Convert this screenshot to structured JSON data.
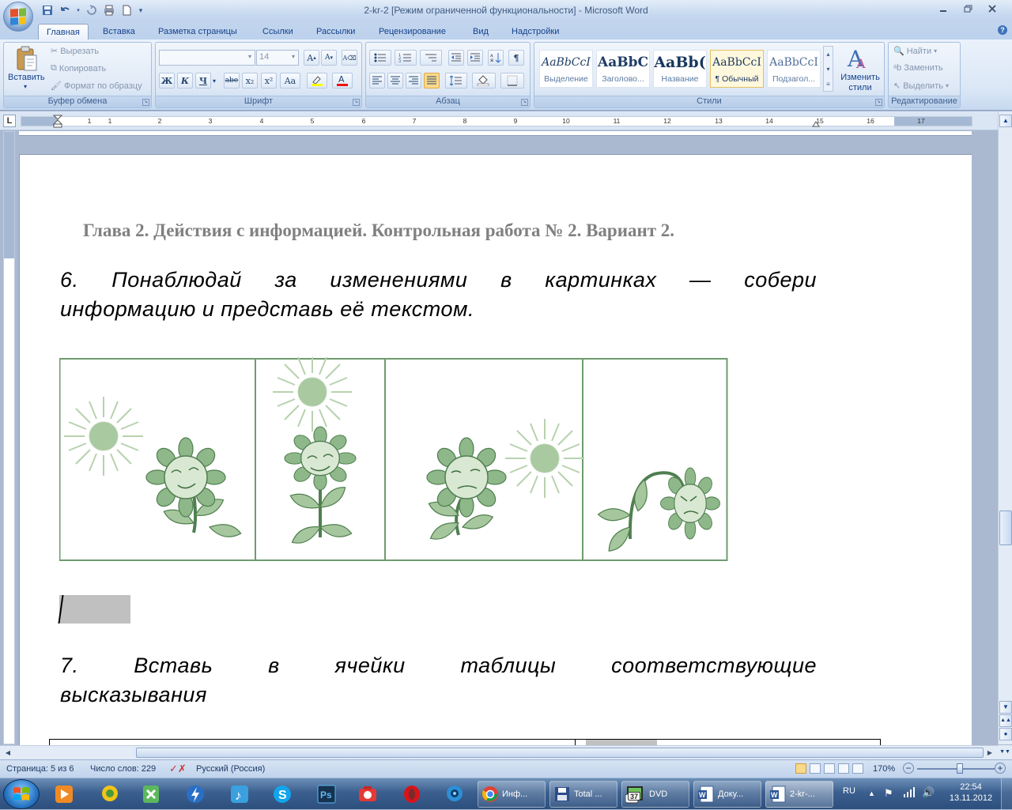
{
  "window": {
    "title": "2-kr-2 [Режим ограниченной функциональности] - Microsoft Word"
  },
  "quick_access": {
    "icons": [
      "save-icon",
      "undo-icon",
      "redo-icon",
      "print-icon",
      "new-document-icon",
      "customize-qat-icon"
    ]
  },
  "tabs": [
    {
      "label": "Главная",
      "active": true
    },
    {
      "label": "Вставка"
    },
    {
      "label": "Разметка страницы"
    },
    {
      "label": "Ссылки"
    },
    {
      "label": "Рассылки"
    },
    {
      "label": "Рецензирование"
    },
    {
      "label": "Вид"
    },
    {
      "label": "Надстройки"
    }
  ],
  "ribbon": {
    "clipboard": {
      "label": "Буфер обмена",
      "paste": "Вставить",
      "cut": "Вырезать",
      "copy": "Копировать",
      "format_painter": "Формат по образцу"
    },
    "font": {
      "label": "Шрифт",
      "font_name": "",
      "font_size": "14",
      "bold": "Ж",
      "italic": "К",
      "underline": "Ч",
      "strike": "abe",
      "subscript": "x₂",
      "superscript": "x²",
      "change_case": "Aa"
    },
    "paragraph": {
      "label": "Абзац"
    },
    "styles": {
      "label": "Стили",
      "items": [
        {
          "preview": "AaBbCcI",
          "name": "Выделение"
        },
        {
          "preview": "AaBbC",
          "name": "Заголово..."
        },
        {
          "preview": "AaBb(",
          "name": "Название"
        },
        {
          "preview": "AaBbCcI",
          "name": "¶ Обычный"
        },
        {
          "preview": "AaBbCcI",
          "name": "Подзагол..."
        }
      ],
      "change_styles": "Изменить стили"
    },
    "editing": {
      "label": "Редактирование",
      "find": "Найти",
      "replace": "Заменить",
      "select": "Выделить"
    }
  },
  "ruler": {
    "numbers": [
      "1",
      "1",
      "2",
      "3",
      "4",
      "5",
      "6",
      "7",
      "8",
      "9",
      "10",
      "11",
      "12",
      "13",
      "14",
      "15",
      "16",
      "17"
    ]
  },
  "document": {
    "header": "Глава 2. Действия с информацией. Контрольная работа № 2. Вариант 2.",
    "task6_line1": "6. Понаблюдай за изменениями в картинках — собери",
    "task6_line2": "информацию и представь её текстом.",
    "task7_line1": "7. Вставь в ячейки таблицы соответствующие",
    "task7_line2": "высказывания",
    "image_description_panels": [
      "sun-left-sunflower-smiling",
      "sun-top-sunflower-smiling",
      "sun-right-sunflower-sad",
      "no-sun-sunflower-drooping"
    ]
  },
  "status": {
    "page": "Страница: 5 из 6",
    "words": "Число слов: 229",
    "language": "Русский (Россия)",
    "zoom": "170%"
  },
  "taskbar": {
    "buttons": [
      {
        "label": "Инф..."
      },
      {
        "label": "Total ..."
      },
      {
        "label": "DVD"
      },
      {
        "label": "Доку..."
      },
      {
        "label": "2-kr-..."
      }
    ],
    "lang": "RU",
    "time": "22:54",
    "date": "13.11.2012",
    "badge": "37"
  },
  "colors": {
    "ribbon_text": "#15428b",
    "sunflower_green": "#6f9b6f",
    "header_gray": "#808080"
  }
}
